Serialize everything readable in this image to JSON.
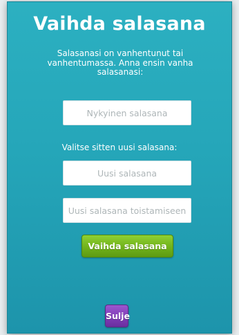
{
  "dialog": {
    "title": "Vaihda salasana",
    "intro": "Salasanasi on vanhentunut tai vanhentumassa. Anna ensin vanha salasanasi:",
    "current_password": {
      "value": "",
      "placeholder": "Nykyinen salasana"
    },
    "new_password_label": "Valitse sitten uusi salasana:",
    "new_password": {
      "value": "",
      "placeholder": "Uusi salasana"
    },
    "repeat_password": {
      "value": "",
      "placeholder": "Uusi salasana toistamiseen"
    },
    "change_button_label": "Vaihda salasana",
    "close_button_label": "Sulje"
  },
  "colors": {
    "panel": "#25a6b9",
    "primary_button": "#71b21b",
    "close_button": "#7d3bb4",
    "text": "#ffffff"
  }
}
